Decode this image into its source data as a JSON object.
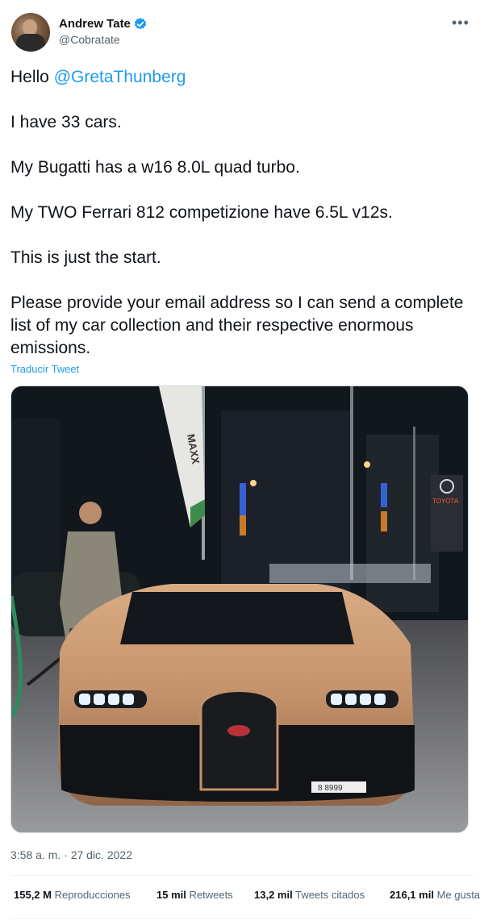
{
  "author": {
    "name": "Andrew Tate",
    "handle": "@Cobratate"
  },
  "tweet": {
    "greeting": "Hello ",
    "mention": "@GretaThunberg",
    "lines": [
      "I have 33 cars.",
      "My Bugatti has a w16 8.0L quad turbo.",
      "My TWO Ferrari 812 competizione have 6.5L v12s.",
      "This is just the start.",
      "Please provide your email address so I can send a complete list of my car collection and their respective enormous emissions."
    ],
    "translate_label": "Traducir Tweet"
  },
  "media": {
    "flag_text": "MAXX",
    "sign_text": "TOYOTA",
    "plate_text": "8 8999",
    "colors": {
      "car_body": "#c4926a",
      "sky": "#141820"
    }
  },
  "timestamp": "3:58 a. m. · 27 dic. 2022",
  "stats": {
    "views": {
      "value": "155,2 M",
      "label": "Reproducciones"
    },
    "retweets": {
      "value": "15 mil",
      "label": "Retweets"
    },
    "quotes": {
      "value": "13,2 mil",
      "label": "Tweets citados"
    },
    "likes": {
      "value": "216,1 mil",
      "label": "Me gusta"
    }
  },
  "colors": {
    "accent": "#1d9bf0",
    "text": "#0f1419",
    "muted": "#536471"
  }
}
